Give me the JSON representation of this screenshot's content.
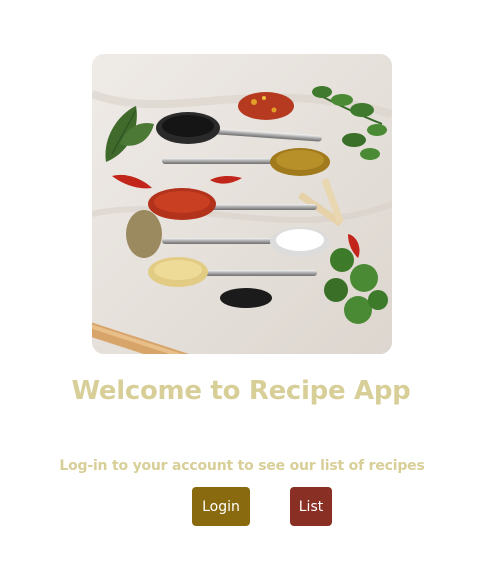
{
  "hero": {
    "image_name": "spices-on-spoons-image"
  },
  "welcome": {
    "title": "Welcome to Recipe App",
    "subtitle": "Log-in to your account to see our list of recipes"
  },
  "actions": {
    "login_label": "Login",
    "list_label": "List"
  },
  "colors": {
    "title": "#d8cf98",
    "login_button": "#8a6a0f",
    "list_button": "#8a2f24",
    "button_text": "#ffffff"
  }
}
